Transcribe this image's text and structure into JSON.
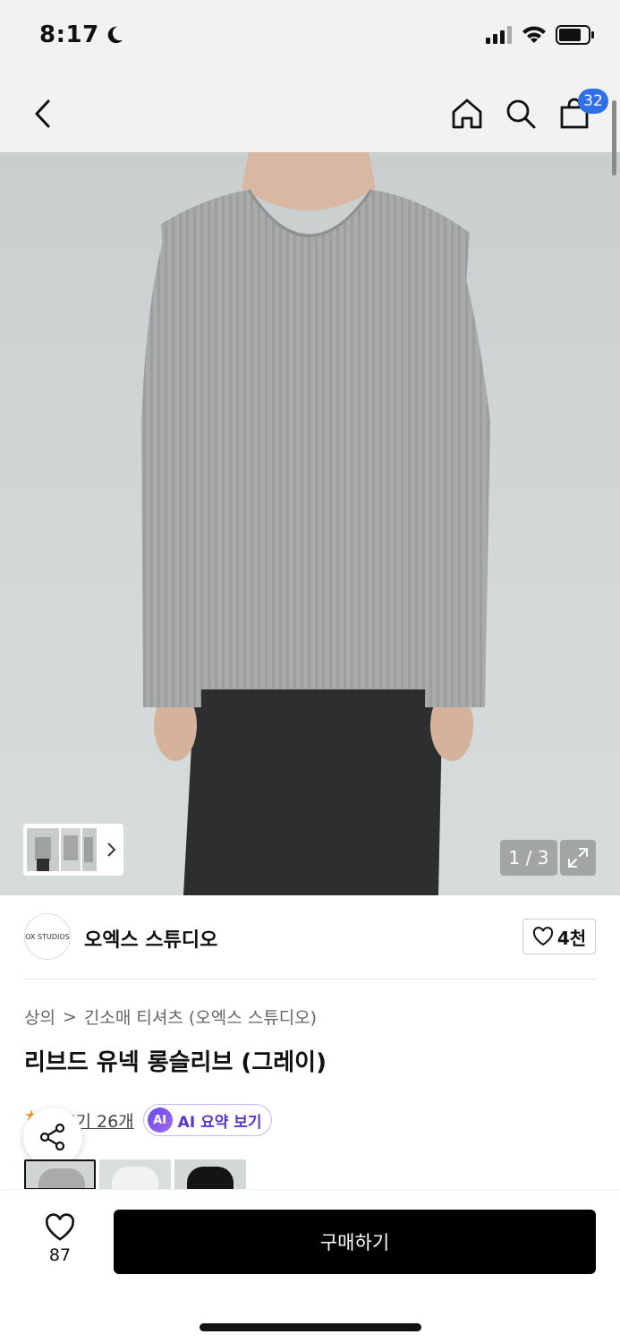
{
  "status_bar": {
    "time": "8:17"
  },
  "nav": {
    "cart_count": "32"
  },
  "gallery": {
    "counter": "1 / 3"
  },
  "brand": {
    "name": "오엑스 스튜디오",
    "logo_text": "OX STUDIOS",
    "likes": "4천"
  },
  "breadcrumb": {
    "category": "상의",
    "separator": ">",
    "subcategory": "긴소매 티셔츠 (오엑스 스튜디오)"
  },
  "product": {
    "title": "리브드 유넥 롱슬리브 (그레이)"
  },
  "reviews": {
    "label": "후기 26개",
    "ai_badge": "AI",
    "ai_summary": "AI 요약 보기"
  },
  "color_options": [
    {
      "name": "gray",
      "color": "#bfc2c2",
      "selected": true
    },
    {
      "name": "white",
      "color": "#e9eaea",
      "selected": false
    },
    {
      "name": "black",
      "color": "#141414",
      "selected": false
    }
  ],
  "bottom_bar": {
    "wish_count": "87",
    "buy_label": "구매하기"
  },
  "colors": {
    "accent_blue": "#2f6fe8",
    "primary": "#000000"
  }
}
